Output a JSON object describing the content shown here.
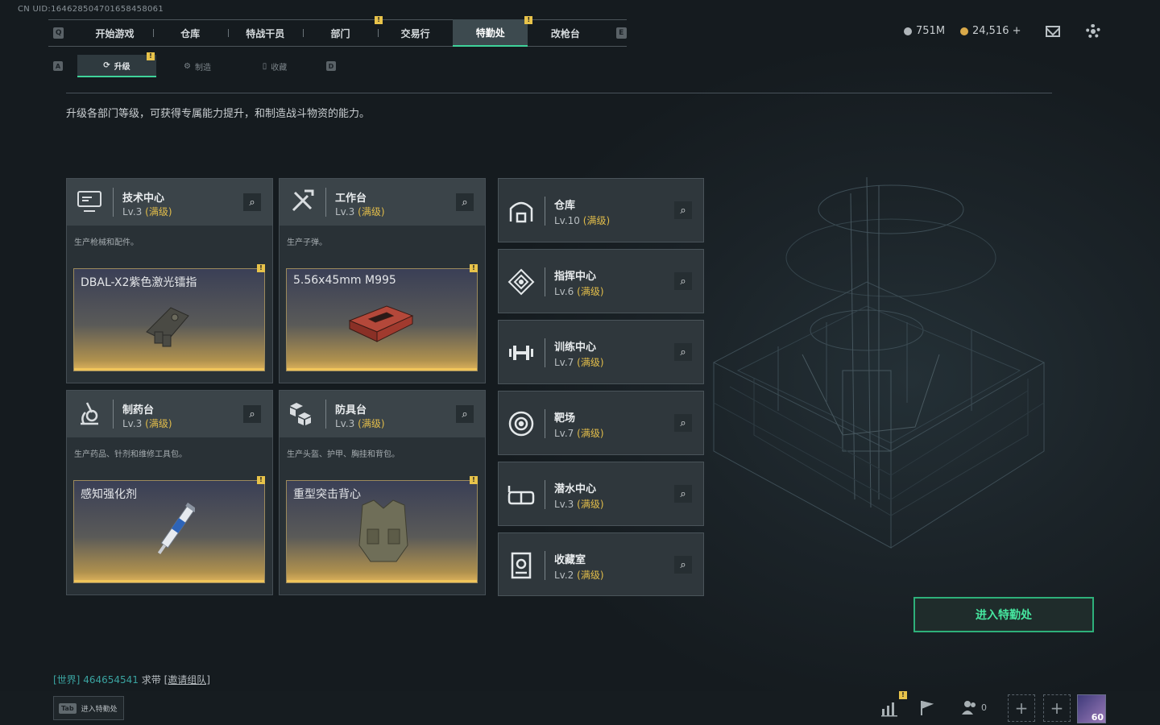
{
  "uid_label": "CN UID:164628504701658458061",
  "top_nav": {
    "left_key": "Q",
    "right_key": "E",
    "items": [
      {
        "label": "开始游戏"
      },
      {
        "label": "仓库"
      },
      {
        "label": "特战干员"
      },
      {
        "label": "部门",
        "badge": "!"
      },
      {
        "label": "交易行"
      },
      {
        "label": "特勤处",
        "badge": "!",
        "active": true
      },
      {
        "label": "改枪台"
      }
    ]
  },
  "currency": {
    "silver": "751M",
    "gold": "24,516 +",
    "silver_color": "#b0b6ba",
    "gold_color": "#d9a94a"
  },
  "sub_nav": {
    "left_key": "A",
    "right_key": "D",
    "tabs": [
      {
        "label": "升级",
        "badge": "!",
        "active": true
      },
      {
        "label": "制造"
      },
      {
        "label": "收藏"
      }
    ]
  },
  "description": "升级各部门等级，可获得专属能力提升，和制造战斗物资的能力。",
  "workbenches": [
    {
      "name": "技术中心",
      "level": "Lv.3",
      "max_label": "(满级)",
      "desc": "生产枪械和配件。",
      "item": "DBAL-X2紫色激光镭指",
      "icon": "computer-icon",
      "badge": "!"
    },
    {
      "name": "工作台",
      "level": "Lv.3",
      "max_label": "(满级)",
      "desc": "生产子弹。",
      "item": "5.56x45mm M995",
      "icon": "tools-icon",
      "badge": "!"
    },
    {
      "name": "制药台",
      "level": "Lv.3",
      "max_label": "(满级)",
      "desc": "生产药品、针剂和维修工具包。",
      "item": "感知强化剂",
      "icon": "microscope-icon",
      "badge": "!"
    },
    {
      "name": "防具台",
      "level": "Lv.3",
      "max_label": "(满级)",
      "desc": "生产头盔、护甲、胸挂和背包。",
      "item": "重型突击背心",
      "icon": "blocks-icon",
      "badge": "!"
    }
  ],
  "facilities": [
    {
      "name": "仓库",
      "level": "Lv.10",
      "max_label": "(满级)",
      "icon": "warehouse-icon"
    },
    {
      "name": "指挥中心",
      "level": "Lv.6",
      "max_label": "(满级)",
      "icon": "command-icon"
    },
    {
      "name": "训练中心",
      "level": "Lv.7",
      "max_label": "(满级)",
      "icon": "dumbbell-icon"
    },
    {
      "name": "靶场",
      "level": "Lv.7",
      "max_label": "(满级)",
      "icon": "target-icon"
    },
    {
      "name": "潜水中心",
      "level": "Lv.3",
      "max_label": "(满级)",
      "icon": "goggles-icon"
    },
    {
      "name": "收藏室",
      "level": "Lv.2",
      "max_label": "(满级)",
      "icon": "collection-icon"
    }
  ],
  "enter_button": "进入特勤处",
  "chat": {
    "channel": "[世界]",
    "user": "464654541",
    "message": "求带",
    "link": "[邀请组队]"
  },
  "tab_hint": {
    "key": "Tab",
    "label": "进入特勤处"
  },
  "bottom": {
    "friends_count": "0",
    "avatar_level": "60",
    "stats_badge": "!"
  },
  "accent": "#3fd39a",
  "max_color": "#e2bd4a"
}
